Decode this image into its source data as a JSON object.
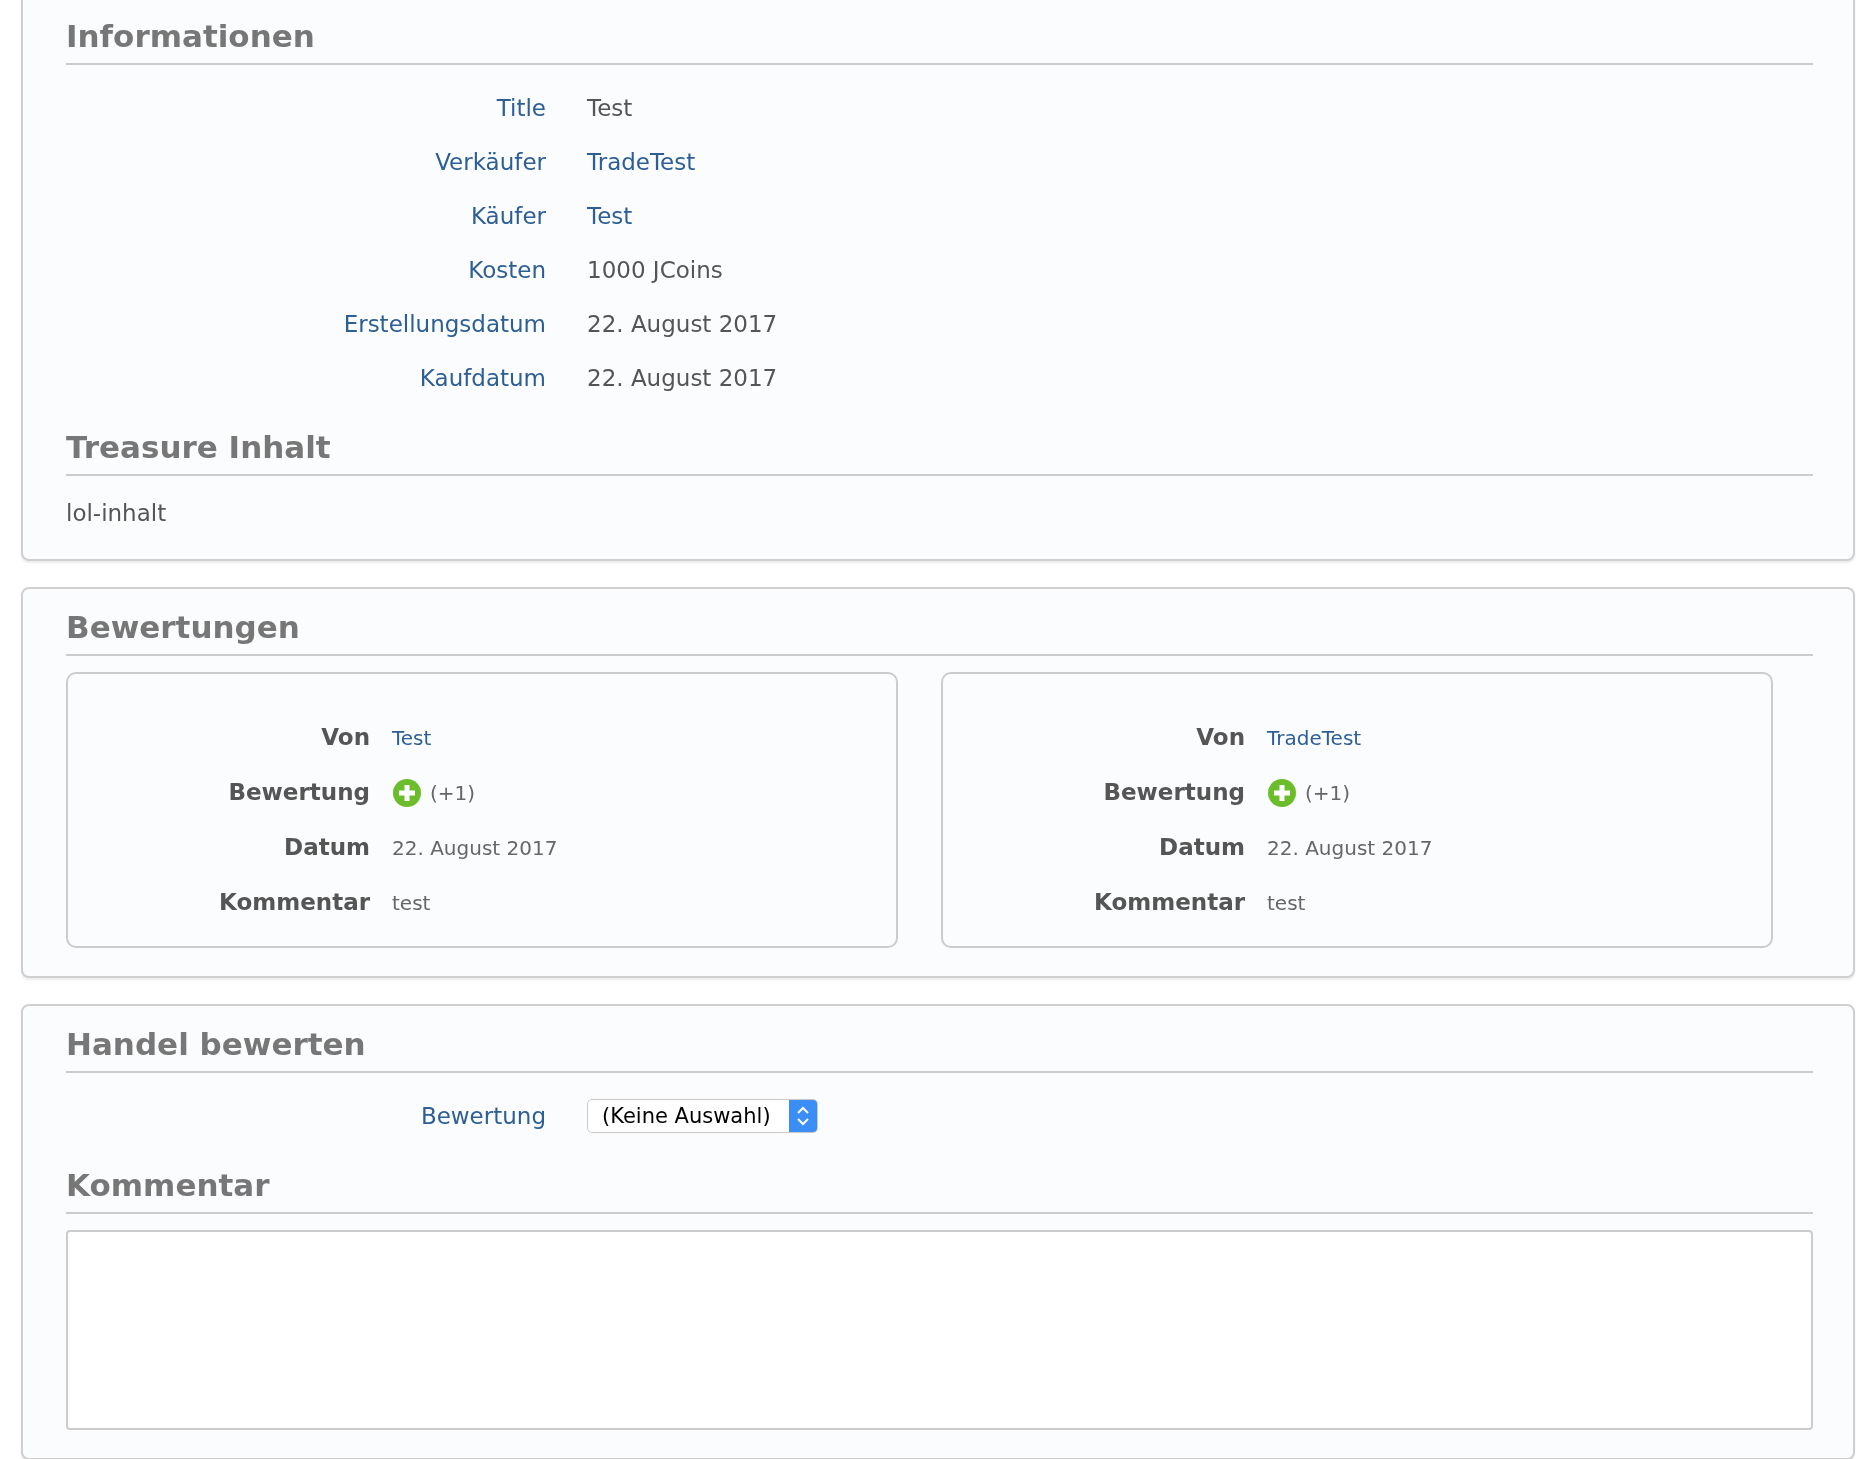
{
  "informationen": {
    "heading": "Informationen",
    "rows": [
      {
        "label": "Title",
        "value": "Test",
        "kind": "text"
      },
      {
        "label": "Verkäufer",
        "value": "TradeTest",
        "kind": "link"
      },
      {
        "label": "Käufer",
        "value": "Test",
        "kind": "link"
      },
      {
        "label": "Kosten",
        "value": "1000 JCoins",
        "kind": "text"
      },
      {
        "label": "Erstellungsdatum",
        "value": "22. August 2017",
        "kind": "text"
      },
      {
        "label": "Kaufdatum",
        "value": "22. August 2017",
        "kind": "text"
      }
    ]
  },
  "treasure": {
    "heading": "Treasure Inhalt",
    "content": "lol-inhalt"
  },
  "bewertungen": {
    "heading": "Bewertungen",
    "cards": [
      {
        "von_label": "Von",
        "von": "Test",
        "bewertung_label": "Bewertung",
        "rating": "(+1)",
        "datum_label": "Datum",
        "datum": "22. August 2017",
        "kommentar_label": "Kommentar",
        "kommentar": "test"
      },
      {
        "von_label": "Von",
        "von": "TradeTest",
        "bewertung_label": "Bewertung",
        "rating": "(+1)",
        "datum_label": "Datum",
        "datum": "22. August 2017",
        "kommentar_label": "Kommentar",
        "kommentar": "test"
      }
    ]
  },
  "handel": {
    "heading": "Handel bewerten",
    "bewertung_label": "Bewertung",
    "bewertung_value": "(Keine Auswahl)",
    "kommentar_heading": "Kommentar"
  }
}
